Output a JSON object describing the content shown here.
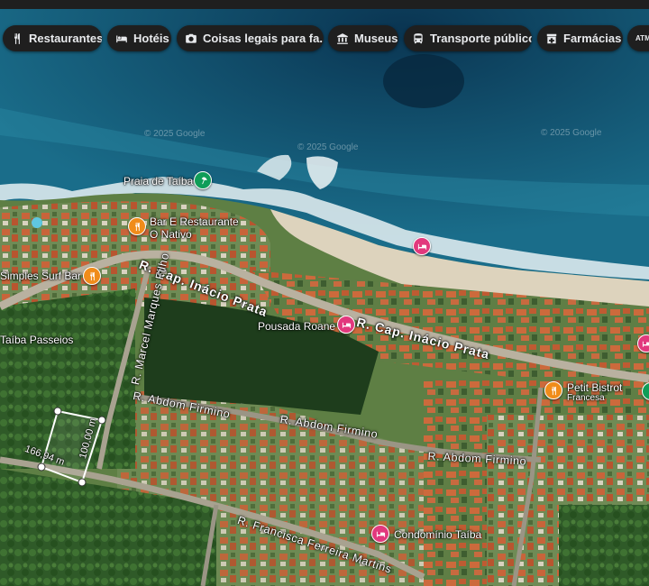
{
  "chips": [
    {
      "label": "Restaurantes",
      "icon": "fork-knife-icon"
    },
    {
      "label": "Hotéis",
      "icon": "bed-icon"
    },
    {
      "label": "Coisas legais para fa...",
      "icon": "camera-icon"
    },
    {
      "label": "Museus",
      "icon": "museum-icon"
    },
    {
      "label": "Transporte público",
      "icon": "bus-icon"
    },
    {
      "label": "Farmácias",
      "icon": "pharmacy-icon"
    },
    {
      "label": "ATM",
      "icon": "atm-icon"
    }
  ],
  "places": {
    "praia": "Praia de Taíba",
    "bar_line1": "Bar E Restaurante",
    "bar_line2": "O Nativo",
    "surf": "Simples Surf Bar",
    "passeios": "Taíba Passeios",
    "pousada": "Pousada Roane",
    "petit": "Petit Bistrot",
    "petit_sub": "Francesa",
    "condominio": "Condomínio Taíba"
  },
  "roads": {
    "cap1": "R. Cap. Inácio Prata",
    "cap2": "R. Cap. Inácio Prata",
    "marcel": "R. Marcel Marques Filho",
    "abdom1": "R. Abdom Firmino",
    "abdom2": "R. Abdom Firmino",
    "abdom3": "R. Abdom Firmino",
    "francisca": "R. Francisca Ferreira Martins"
  },
  "measure": {
    "width_label": "166,94 m",
    "height_label": "100,00 m"
  },
  "watermarks": [
    "© 2025 Google",
    "© 2025 Google",
    "© 2025 Google"
  ],
  "colors": {
    "restaurant": "#f08c1a",
    "hotel": "#e2387d",
    "beach": "#0f9d58",
    "chip_bg": "#1f1f1f"
  }
}
